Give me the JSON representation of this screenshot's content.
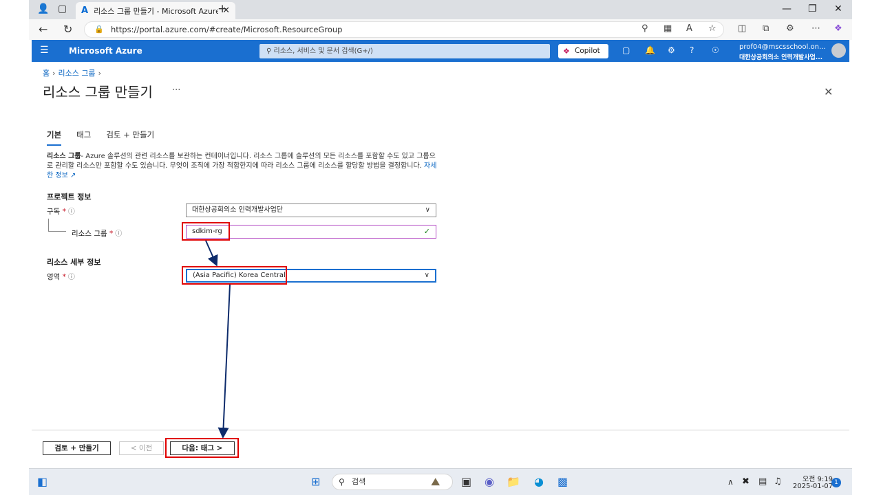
{
  "browser": {
    "tab_title": "리소스 그룹 만들기 - Microsoft Azure",
    "tab_logo": "A",
    "new_tab": "+",
    "url": "https://portal.azure.com/#create/Microsoft.ResourceGroup"
  },
  "azure": {
    "brand": "Microsoft Azure",
    "search_placeholder": "리소스, 서비스 및 문서 검색(G+/)",
    "copilot": "Copilot",
    "user_email": "prof04@mscsschool.on...",
    "user_org": "대한상공회의소 인력개발사업..."
  },
  "breadcrumb": {
    "home": "홈",
    "rg": "리소스 그룹"
  },
  "page": {
    "title": "리소스 그룹 만들기",
    "more": "···"
  },
  "tabs": [
    "기본",
    "태그",
    "검토 + 만들기"
  ],
  "description": {
    "bold": "리소스 그룹",
    "text": "- Azure 솔루션의 관련 리소스를 보관하는 컨테이너입니다. 리소스 그룹에 솔루션의 모든 리소스를 포함할 수도 있고 그룹으로 관리할 리소스만 포함할 수도 있습니다. 무엇이 조직에 가장 적합한지에 따라 리소스 그룹에 리소스를 할당할 방법을 결정합니다.",
    "link": "자세한 정보"
  },
  "project": {
    "heading": "프로젝트 정보",
    "subscription_label": "구독",
    "subscription_value": "대한상공회의소 인력개발사업단",
    "rg_label": "리소스 그룹",
    "rg_value": "sdkim-rg"
  },
  "resource": {
    "heading": "리소스 세부 정보",
    "region_label": "영역",
    "region_value": "(Asia Pacific) Korea Central"
  },
  "required_mark": "*",
  "footer": {
    "review": "검토 + 만들기",
    "prev": "< 이전",
    "next": "다음: 태그 >"
  },
  "taskbar": {
    "search": "검색",
    "ampm_time": "오전 9:19",
    "date": "2025-01-07",
    "badge": "1"
  },
  "colors": {
    "azure_blue": "#1a6fd0",
    "annotation_red": "#e00000",
    "arrow_navy": "#0d2b6b",
    "valid_green": "#107c10"
  }
}
